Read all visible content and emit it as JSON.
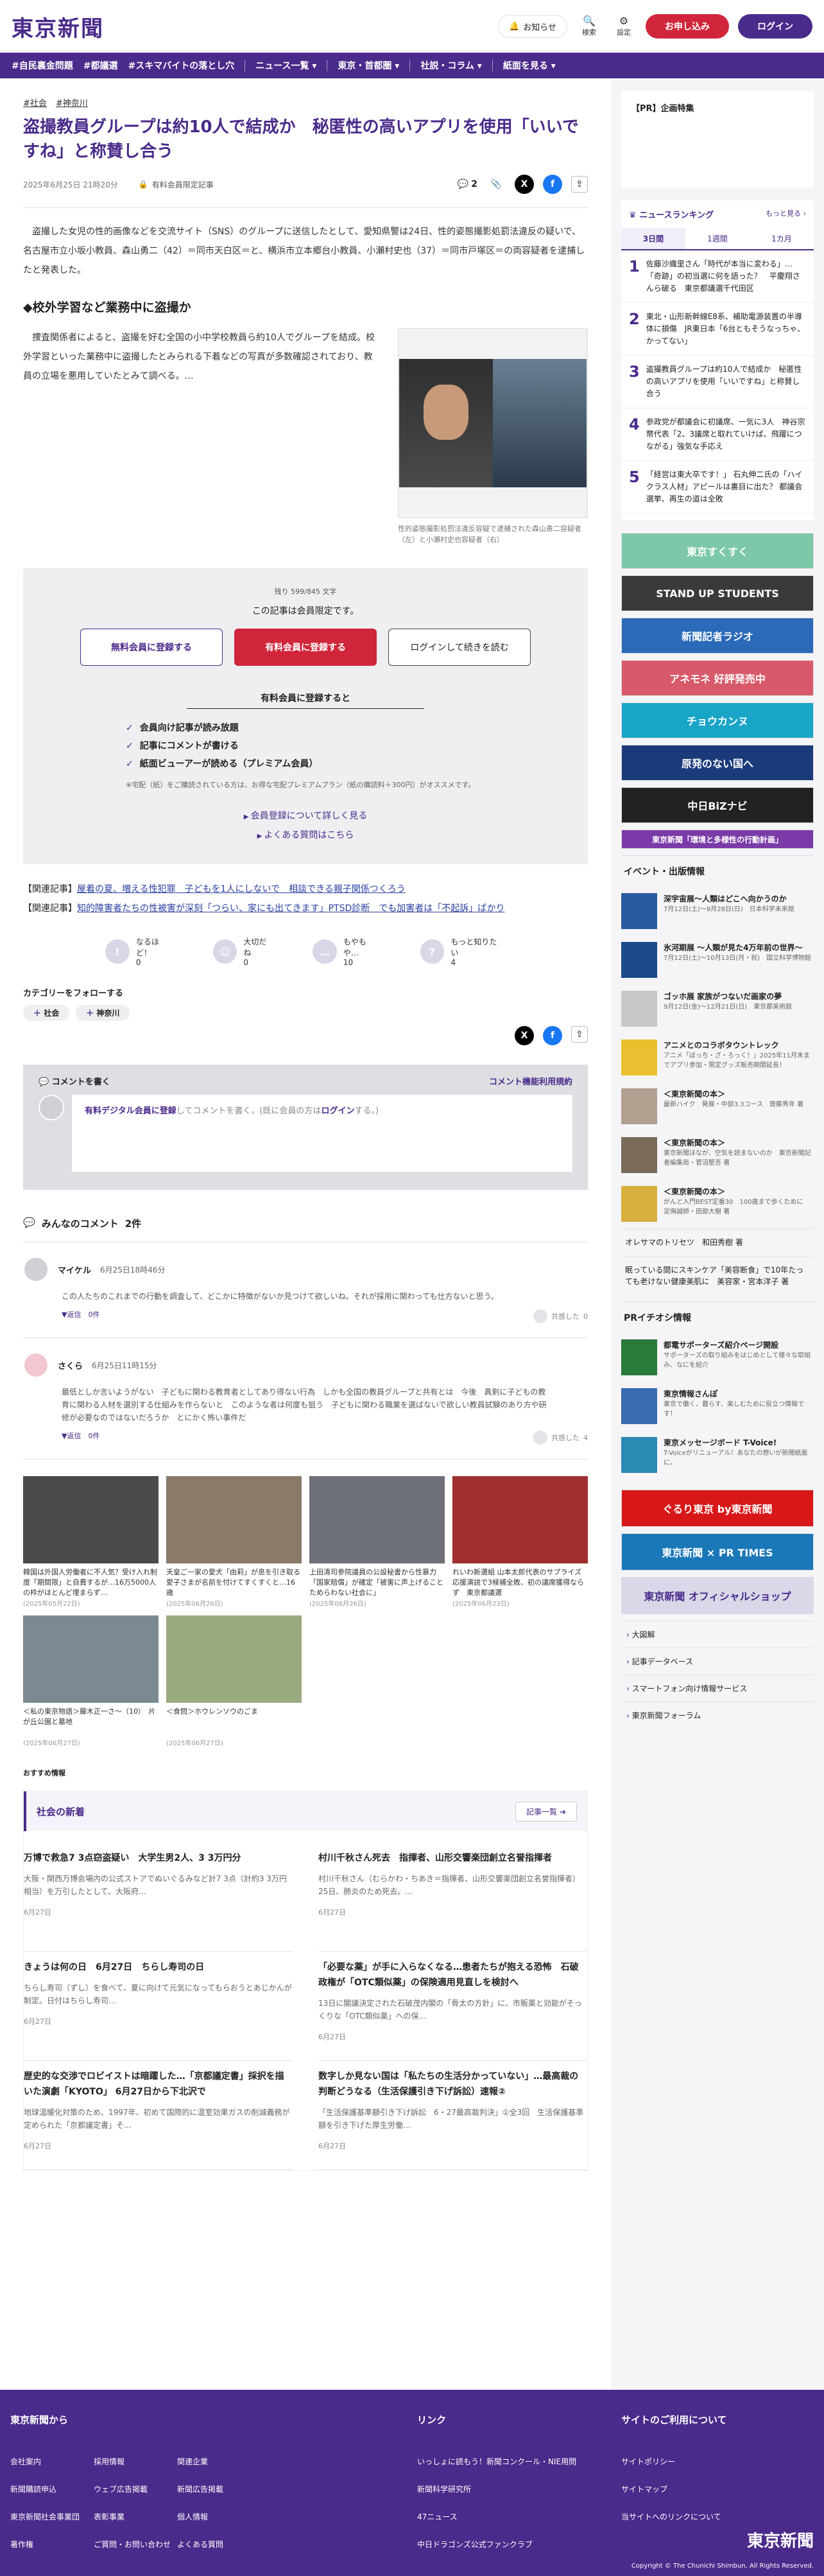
{
  "header": {
    "logo": "東京新聞",
    "notify": "お知らせ",
    "search": "検索",
    "settings": "設定",
    "apply": "お申し込み",
    "login": "ログイン"
  },
  "nav": {
    "topics": [
      "#自民裏金問題",
      "#都議選",
      "#スキマバイトの落とし穴"
    ],
    "menus": [
      "ニュース一覧",
      "東京・首都圏",
      "社説・コラム",
      "紙面を見る"
    ]
  },
  "article": {
    "tags": [
      "#社会",
      "#神奈川"
    ],
    "title": "盗撮教員グループは約10人で結成か　秘匿性の高いアプリを使用「いいですね」と称賛し合う",
    "date": "2025年6月25日 21時20分",
    "member_only": "有料会員限定記事",
    "comment_count": "2",
    "lead": "盗撮した女児の性的画像などを交流サイト（SNS）のグループに送信したとして、愛知県警は24日、性的姿態撮影処罰法違反の疑いで、名古屋市立小坂小教員、森山勇二（42）＝同市天白区＝と、横浜市立本郷台小教員、小瀬村史也（37）＝同市戸塚区＝の両容疑者を逮捕したと発表した。",
    "h2": "◆校外学習など業務中に盗撮か",
    "body": "捜査関係者によると、盗撮を好む全国の小中学校教員ら約10人でグループを結成。校外学習といった業務中に盗撮したとみられる下着などの写真が多数確認されており、教員の立場を悪用していたとみて調べる。…",
    "caption": "性的姿態撮影処罰法違反容疑で逮捕された森山勇二容疑者（左）と小瀬村史也容疑者（右）"
  },
  "paywall": {
    "count": "残り 599/845 文字",
    "lead": "この記事は会員限定です。",
    "free": "無料会員に登録する",
    "paid": "有料会員に登録する",
    "login": "ログインして続きを読む",
    "subhead": "有料会員に登録すると",
    "benefits": [
      "会員向け記事が読み放題",
      "記事にコメントが書ける",
      "紙面ビューアーが読める（プレミアム会員）"
    ],
    "note": "※宅配（紙）をご購読されている方は、お得な宅配プレミアムプラン（紙の購読料＋300円）がオススメです。",
    "link1": "会員登録について詳しく見る",
    "link2": "よくある質問はこちら"
  },
  "related": [
    {
      "label": "【関連記事】",
      "text": "屋着の夏、増える性犯罪　子どもを1人にしないで　相談できる親子関係つくろう"
    },
    {
      "label": "【関連記事】",
      "text": "知的障害者たちの性被害が深刻「つらい、家にも出てきます」PTSD診断　でも加害者は「不起訴」ばかり"
    }
  ],
  "reactions": [
    {
      "icon": "!",
      "label": "なるほど！",
      "count": "0"
    },
    {
      "icon": "☺",
      "label": "大切だね",
      "count": "0"
    },
    {
      "icon": "…",
      "label": "もやもや…",
      "count": "10"
    },
    {
      "icon": "?",
      "label": "もっと知りたい",
      "count": "4"
    }
  ],
  "follow": {
    "title": "カテゴリーをフォローする",
    "chips": [
      "社会",
      "神奈川"
    ]
  },
  "comment_box": {
    "title": "コメントを書く",
    "rules": "コメント機能利用規約",
    "placeholder_strong": "有料デジタル会員に登録",
    "placeholder_mid": "してコメントを書く。(既に会員の方は",
    "placeholder_login": "ログイン",
    "placeholder_end": "する。)"
  },
  "comments": {
    "title": "みんなのコメント",
    "count": "2件",
    "items": [
      {
        "name": "マイケル",
        "date": "6月25日18時46分",
        "body": "この人たちのこれまでの行動を調査して、どこかに特徴がないか見つけて欲しいね。それが採用に関わっても仕方ないと思う。",
        "reply": "返信　0件",
        "agree": "共感した",
        "agree_count": "0"
      },
      {
        "name": "さくら",
        "date": "6月25日11時15分",
        "body": "最低としか言いようがない　子どもに関わる教育者としてあり得ない行為　しかも全国の教員グループと共有とは　今後　真剣に子どもの教育に関わる人材を選別する仕組みを作らないと　このような者は何度も狙う　子どもに関わる職業を選ばないで欲しい教員試験のあり方や研修が必要なのではないだろうか　とにかく怖い事件だ",
        "reply": "返信　0件",
        "agree": "共感した",
        "agree_count": "4"
      }
    ]
  },
  "photos": [
    {
      "cap": "韓国は外国人労働者に不人気？受け入れ制度「期間限」と自費するが…16万5000人の枠がほとんど埋まらず…",
      "date": "(2025年05月22日)",
      "color": "#4b4b4b"
    },
    {
      "cap": "天皇ご一家の愛犬「由莉」が息を引き取る　愛子さまが名前を付けてすくすくと…16歳",
      "date": "(2025年06月26日)",
      "color": "#8a7a6a"
    },
    {
      "cap": "上田清司参院議員の公設秘書から性暴力「国家賠償」が確定「被害に声上げることためらわない社会に」",
      "date": "(2025年06月26日)",
      "color": "#6d7078"
    },
    {
      "cap": "れいわ新選組 山本太郎代表のサプライズ応援演説で3候補全敗、初の議席獲得ならず　東京都議選",
      "date": "(2025年06月23日)",
      "color": "#a03030"
    },
    {
      "cap": "＜私の東京物語＞藤木正一さ〜（10）　片が丘公園と墓地",
      "date": "(2025年06月27日)",
      "color": "#7a8a90"
    },
    {
      "cap": "＜食問＞ホウレンソウのごま",
      "date": "(2025年06月27日)",
      "color": "#9aaa80"
    }
  ],
  "recommend": "おすすめ情報",
  "news": {
    "title": "社会の新着",
    "more": "記事一覧",
    "items": [
      {
        "title": "万博で救急7 3点窃盗疑い　大学生男2人、3 3万円分",
        "body": "大阪・関西万博会場内の公式ストアでぬいぐるみなど計7 3点（計約3 3万円相当）を万引したとして、大阪府…",
        "date": "6月27日"
      },
      {
        "title": "村川千秋さん死去　指揮者、山形交響楽団創立名誉指揮者",
        "body": "村川千秋さん（むらかわ・ちあき＝指揮者、山形交響楽団創立名誉指揮者）25日、肺炎のため死去。…",
        "date": "6月27日"
      },
      {
        "title": "きょうは何の日　6月27日　ちらし寿司の日",
        "body": "ちらし寿司（ずし）を食べて、夏に向けて元気になってもらおうとあじかんが制定。日付はちらし寿司…",
        "date": "6月27日"
      },
      {
        "title": "「必要な薬」が手に入らなくなる…患者たちが抱える恐怖　石破政権が「OTC類似薬」の保険適用見直しを検討へ",
        "body": "13日に閣議決定された石破茂内閣の「骨太の方針」に、市販薬と効能がそっくりな「OTC類似薬」への保…",
        "date": "6月27日"
      },
      {
        "title": "歴史的な交渉でロビイストは暗躍した…「京都議定書」採択を描いた演劇「KYOTO」 6月27日から下北沢で",
        "body": "地球温暖化対策のため、1997年、初めて国際的に温室効果ガスの削減義務が定められた「京都議定書」そ…",
        "date": "6月27日"
      },
      {
        "title": "数字しか見ない国は「私たちの生活分かっていない」…最高裁の判断どうなる（生活保護引き下げ訴訟）速報②",
        "body": "「生活保護基準額引き下げ訴訟　6・27最高裁判決」①全3回　生活保護基準額を引き下げた厚生労働…",
        "date": "6月27日"
      }
    ]
  },
  "sidebar": {
    "pr_title": "【PR】企画特集",
    "ranking_title": "ニュースランキング",
    "ranking_more": "もっと見る",
    "tabs": [
      "3日間",
      "1週間",
      "1カ月"
    ],
    "ranking": [
      {
        "n": "1",
        "t": "佐藤沙織里さん「時代が本当に変わる」…「奇跡」の初当選に何を語った？　平慶翔さんら破る　東京都議選千代田区"
      },
      {
        "n": "2",
        "t": "東北・山形新幹線E8系、補助電源装置の半導体に損傷　JR東日本「6台ともそうなっちゃ、かってない」"
      },
      {
        "n": "3",
        "t": "盗撮教員グループは約10人で結成か　秘匿性の高いアプリを使用「いいですね」と称賛し合う"
      },
      {
        "n": "4",
        "t": "参政党が都議会に初議席、一気に3人　神谷宗幣代表「2、3議席と取れていけば、飛躍につながる」強気な手応え"
      },
      {
        "n": "5",
        "t": "「経営は東大卒です！」 石丸伸二氏の「ハイクラス人材」アピールは裏目に出た？ 都議会選挙、再生の道は全敗"
      }
    ],
    "banners": [
      {
        "text": "東京すくすく",
        "bg": "#7cc8a8"
      },
      {
        "text": "STAND UP STUDENTS",
        "bg": "#3a3a3a"
      },
      {
        "text": "新聞記者ラジオ",
        "bg": "#2a6ab8"
      },
      {
        "text": "アネモネ 好評発売中",
        "bg": "#d85a6a"
      },
      {
        "text": "チョウカンヌ",
        "bg": "#19a5c8"
      },
      {
        "text": "原発のない国へ",
        "bg": "#1a3a7a"
      },
      {
        "text": "中日BiZナビ",
        "bg": "#222222"
      },
      {
        "text": "東京新聞「環境と多様性の行動計画」",
        "bg": "#7a3aa8"
      }
    ],
    "events_title": "イベント・出版情報",
    "events": [
      {
        "t": "深宇宙展〜人類はどこへ向かうのか",
        "s": "7月12日(土)〜9月28日(日)　日本科学未来館",
        "color": "#2a5aa0"
      },
      {
        "t": "氷河期展 〜人類が見た4万年前の世界〜",
        "s": "7月12日(土)〜10月13日(月・祝)　国立科学博物館",
        "color": "#1a4a8a"
      },
      {
        "t": "ゴッホ展 家族がつないだ画家の夢",
        "s": "9月12日(金)〜12月21日(日)　東京都美術館",
        "color": "#c8c8c8"
      },
      {
        "t": "アニメとのコラボタウントレック",
        "s": "アニメ「ぼっち・ざ・ろっく！」2025年11月末までアプリ参加・限定グッズ販売期間延長！",
        "color": "#e8c030"
      },
      {
        "t": "＜東京新聞の本＞",
        "s": "最新ハイク　発展・中部3.3コース　齋藤秀年 著",
        "color": "#b0a090"
      },
      {
        "t": "＜東京新聞の本＞",
        "s": "東京新聞ほなが、空気を読まないのか　東京新聞記者編集局・菅沼堅吾 著",
        "color": "#7a6a5a"
      },
      {
        "t": "＜東京新聞の本＞",
        "s": "がんと入門BEST定番30　100歳まで歩くために　足侮誠師・田部大樹 著",
        "color": "#d8b040"
      }
    ],
    "texts": [
      "オレサマのトリセツ　和田秀樹 著",
      "眠っている間にスキンケア「美容断食」で10年たっても老けない健康美肌に　美容家・宮本洋子 著"
    ],
    "pr_events_title": "PRイチオシ情報",
    "pr_events": [
      {
        "t": "都電サポーターズ紹介ページ開設",
        "s": "サポーターズの取り組みをはじめとして様々な取組み、なにを紹介",
        "color": "#2a7a3a"
      },
      {
        "t": "東京情報さんぽ",
        "s": "東京で働く、暮らす、楽しむために役立つ情報です！",
        "color": "#3a6ab0"
      },
      {
        "t": "東京メッセージボード T-Voice!",
        "s": "T-Voiceがリニューアル！あなたの想いが新聞紙面に。",
        "color": "#2a8ab0"
      }
    ],
    "big_banners": [
      {
        "text": "ぐるり東京 by東京新聞",
        "bg": "#d81818"
      },
      {
        "text": "東京新聞 × PR TIMES",
        "bg": "#1a78b8"
      },
      {
        "text": "東京新聞 オフィシャルショップ",
        "bg": "#d8d8e8"
      }
    ],
    "links": [
      "大図解",
      "記事データベース",
      "スマートフォン向け情報サービス",
      "東京新聞フォーラム"
    ]
  },
  "footer": {
    "col1_title": "東京新聞から",
    "col1_links": [
      "会社案内",
      "採用情報",
      "関連企業",
      "新聞購読申込",
      "ウェブ広告掲載",
      "新聞広告掲載",
      "東京新聞社会事業団",
      "表彰事業",
      "個人情報",
      "著作権",
      "ご質問・お問い合わせ",
      "よくある質問"
    ],
    "col2_title": "リンク",
    "col2_links": [
      "いっしょに読もう！新聞コンクール・NIE用問",
      "新聞科学研究所",
      "47ニュース",
      "中日ドラゴンズ公式ファンクラブ"
    ],
    "col3_title": "サイトのご利用について",
    "col3_links": [
      "サイトポリシー",
      "サイトマップ",
      "当サイトへのリンクについて"
    ],
    "logo": "東京新聞",
    "copyright": "Copyright © The Chunichi Shimbun, All Rights Reserved."
  }
}
